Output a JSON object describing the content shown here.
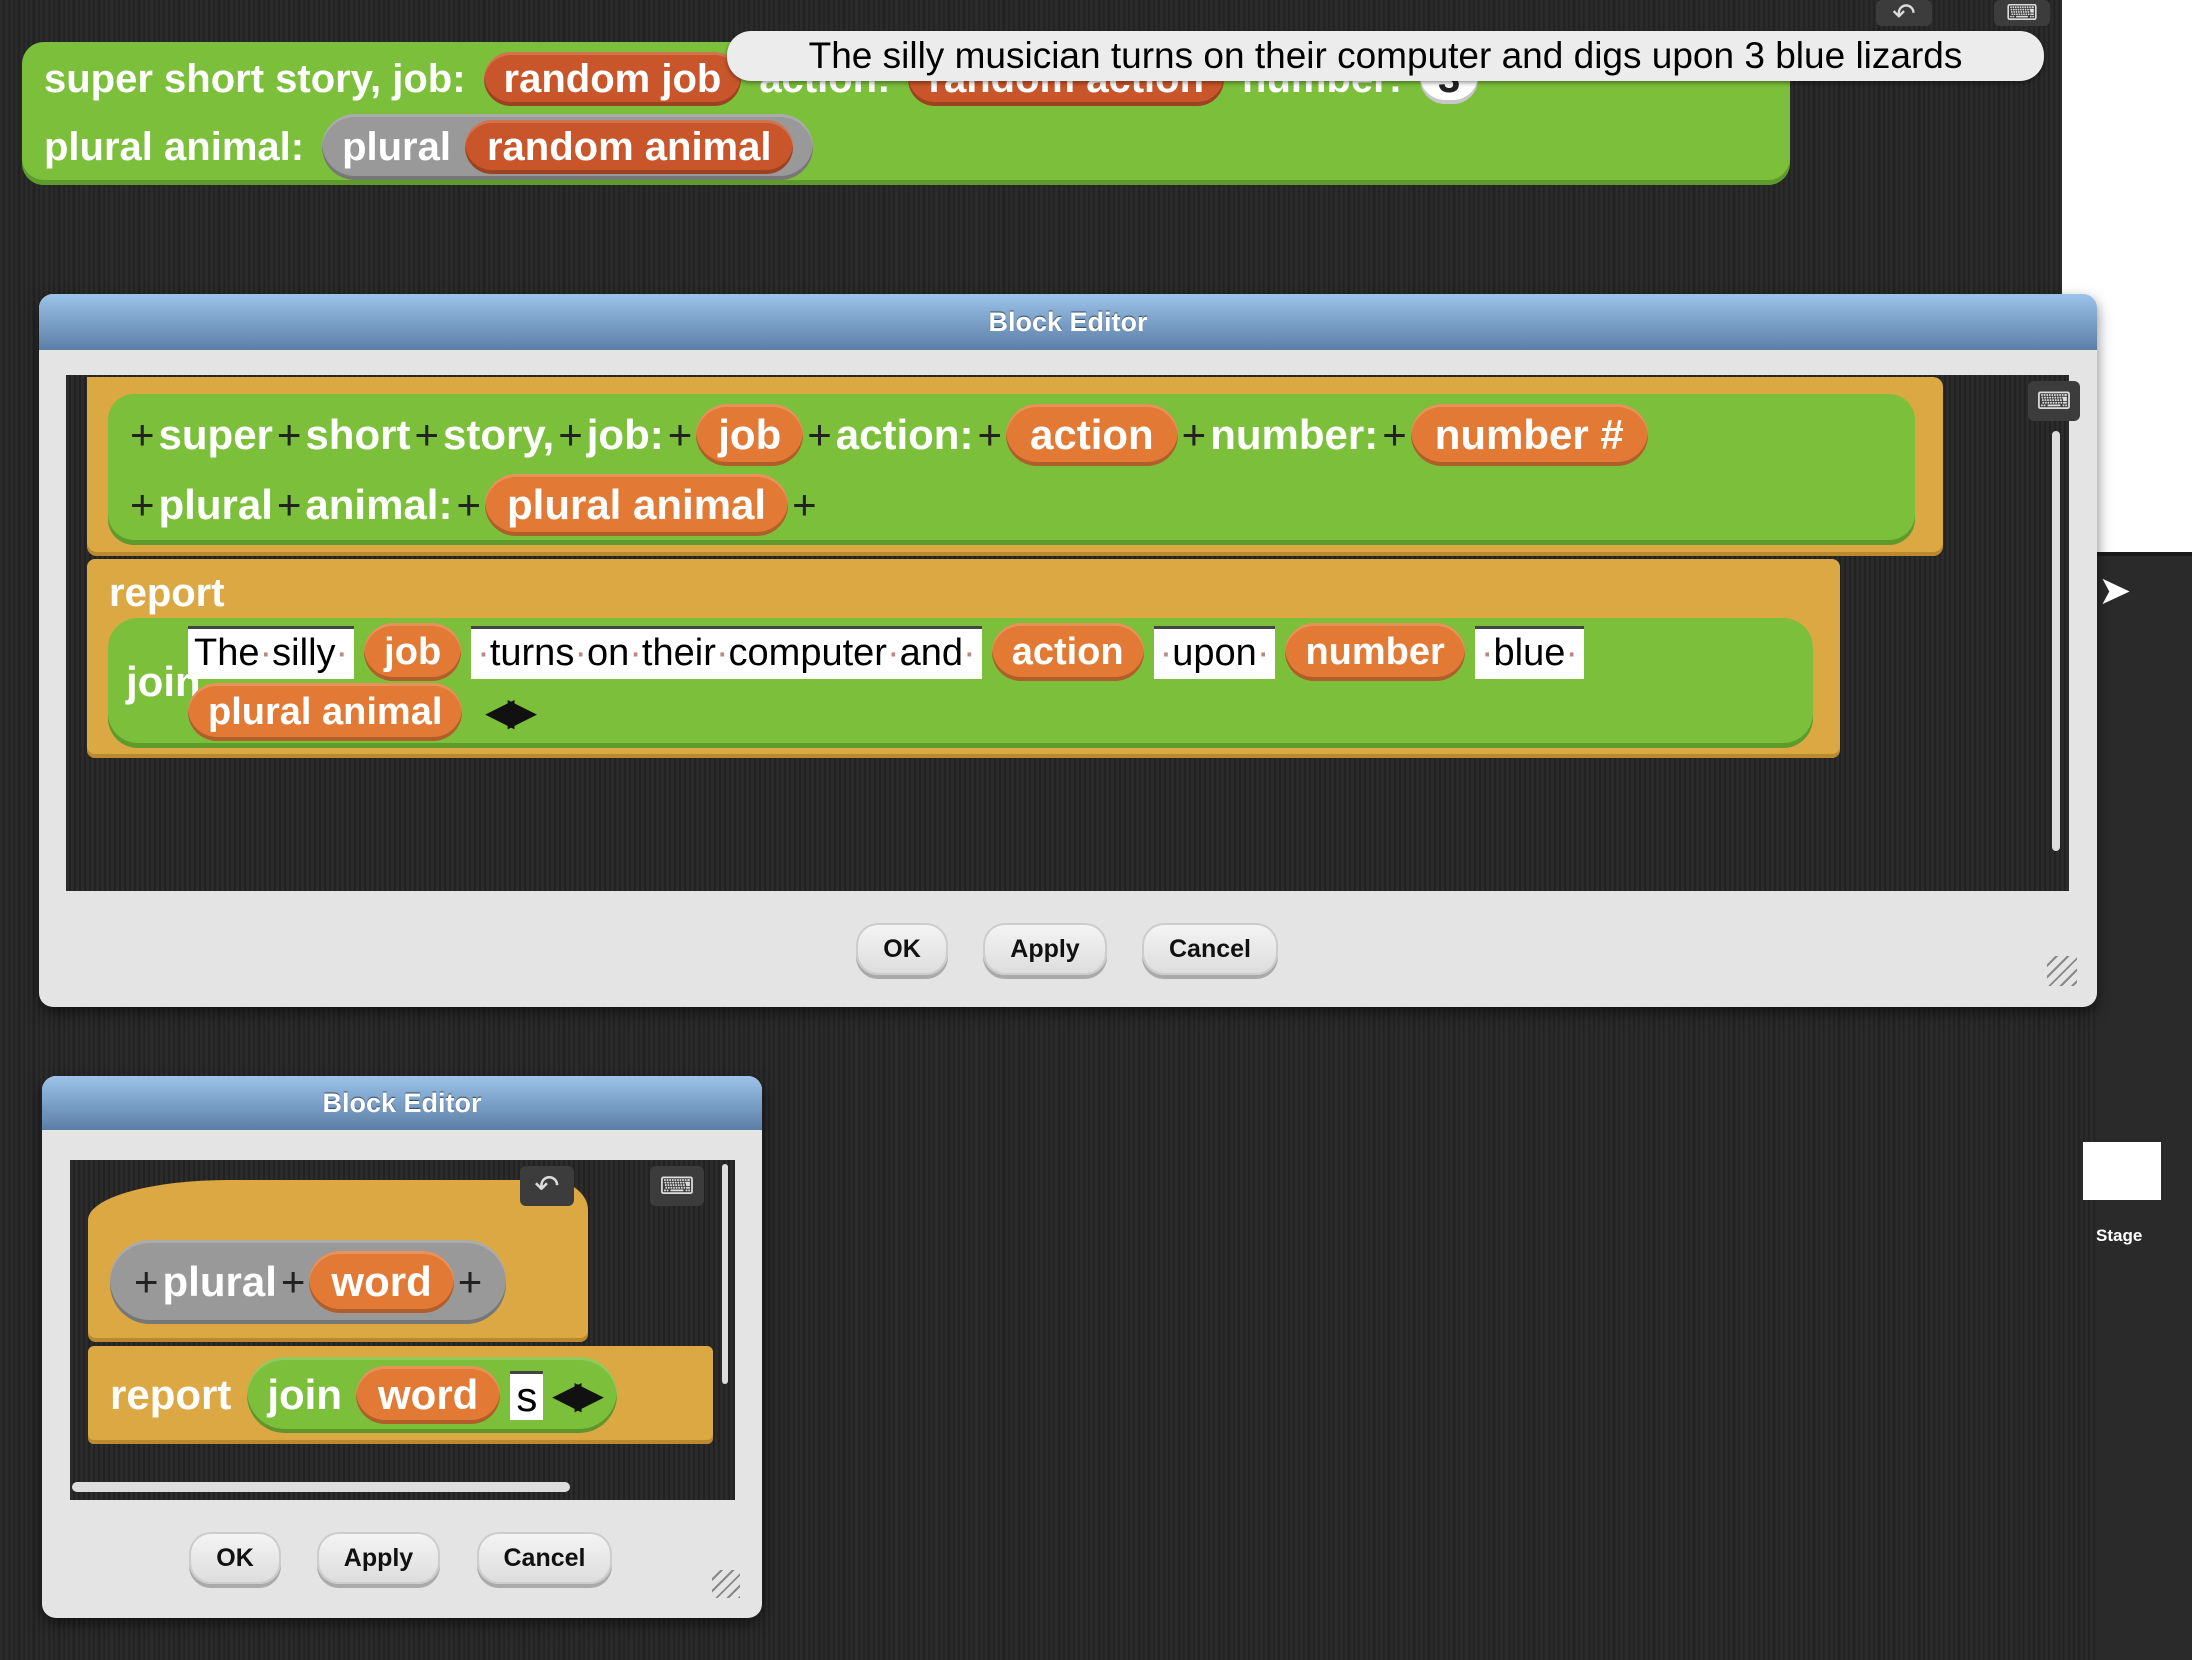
{
  "workspace": {
    "top_block": {
      "label1": "super short story, job:",
      "job": "random job",
      "label2": "action:",
      "action": "random action",
      "label3": "number:",
      "number": "3",
      "label4": "plural animal:",
      "plural": "plural",
      "animal": "random animal"
    },
    "tooltip": "The silly musician turns on their computer and digs upon 3 blue lizards",
    "stage_label": "Stage"
  },
  "editor_main": {
    "title": "Block Editor",
    "prototype": {
      "w1": "super",
      "w2": "short",
      "w3": "story,",
      "w4": "job:",
      "p_job": "job",
      "w5": "action:",
      "p_action": "action",
      "w6": "number:",
      "p_number": "number #",
      "w7": "plural",
      "w8": "animal:",
      "p_plural_animal": "plural animal"
    },
    "report": "report",
    "join": "join",
    "join_inputs": {
      "t1": "The silly ",
      "v1": "job",
      "t2": " turns on their computer and ",
      "v2": "action",
      "t3": " upon ",
      "v3": "number",
      "t4": " blue ",
      "v4": "plural animal"
    },
    "buttons": {
      "ok": "OK",
      "apply": "Apply",
      "cancel": "Cancel"
    }
  },
  "editor_small": {
    "title": "Block Editor",
    "prototype": {
      "w1": "plural",
      "p_word": "word"
    },
    "report": "report",
    "join": "join",
    "join_inputs": {
      "v1": "word",
      "t1": "s"
    },
    "buttons": {
      "ok": "OK",
      "apply": "Apply",
      "cancel": "Cancel"
    }
  },
  "colors": {
    "command_green": "#7bbf3b",
    "variable_orange": "#e27a36",
    "control_gold": "#dba843",
    "other_gray": "#999999"
  }
}
